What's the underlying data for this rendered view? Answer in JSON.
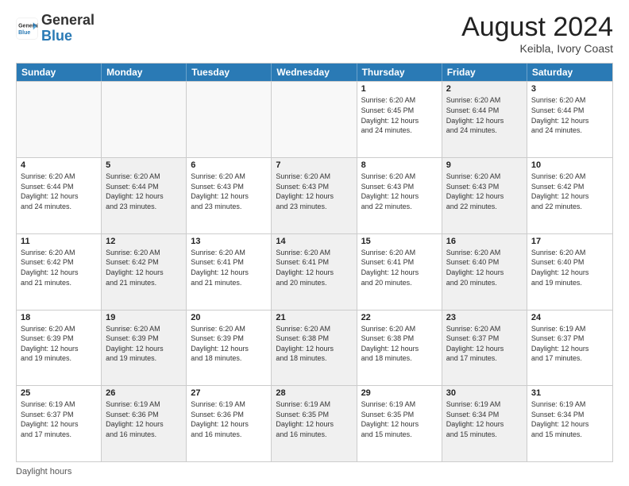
{
  "header": {
    "logo_general": "General",
    "logo_blue": "Blue",
    "month_year": "August 2024",
    "location": "Keibla, Ivory Coast"
  },
  "days_of_week": [
    "Sunday",
    "Monday",
    "Tuesday",
    "Wednesday",
    "Thursday",
    "Friday",
    "Saturday"
  ],
  "footer": {
    "label": "Daylight hours"
  },
  "weeks": [
    [
      {
        "day": "",
        "empty": true
      },
      {
        "day": "",
        "empty": true
      },
      {
        "day": "",
        "empty": true
      },
      {
        "day": "",
        "empty": true
      },
      {
        "day": "1",
        "lines": [
          "Sunrise: 6:20 AM",
          "Sunset: 6:45 PM",
          "Daylight: 12 hours",
          "and 24 minutes."
        ],
        "shaded": false
      },
      {
        "day": "2",
        "lines": [
          "Sunrise: 6:20 AM",
          "Sunset: 6:44 PM",
          "Daylight: 12 hours",
          "and 24 minutes."
        ],
        "shaded": true
      },
      {
        "day": "3",
        "lines": [
          "Sunrise: 6:20 AM",
          "Sunset: 6:44 PM",
          "Daylight: 12 hours",
          "and 24 minutes."
        ],
        "shaded": false
      }
    ],
    [
      {
        "day": "4",
        "lines": [
          "Sunrise: 6:20 AM",
          "Sunset: 6:44 PM",
          "Daylight: 12 hours",
          "and 24 minutes."
        ],
        "shaded": false
      },
      {
        "day": "5",
        "lines": [
          "Sunrise: 6:20 AM",
          "Sunset: 6:44 PM",
          "Daylight: 12 hours",
          "and 23 minutes."
        ],
        "shaded": true
      },
      {
        "day": "6",
        "lines": [
          "Sunrise: 6:20 AM",
          "Sunset: 6:43 PM",
          "Daylight: 12 hours",
          "and 23 minutes."
        ],
        "shaded": false
      },
      {
        "day": "7",
        "lines": [
          "Sunrise: 6:20 AM",
          "Sunset: 6:43 PM",
          "Daylight: 12 hours",
          "and 23 minutes."
        ],
        "shaded": true
      },
      {
        "day": "8",
        "lines": [
          "Sunrise: 6:20 AM",
          "Sunset: 6:43 PM",
          "Daylight: 12 hours",
          "and 22 minutes."
        ],
        "shaded": false
      },
      {
        "day": "9",
        "lines": [
          "Sunrise: 6:20 AM",
          "Sunset: 6:43 PM",
          "Daylight: 12 hours",
          "and 22 minutes."
        ],
        "shaded": true
      },
      {
        "day": "10",
        "lines": [
          "Sunrise: 6:20 AM",
          "Sunset: 6:42 PM",
          "Daylight: 12 hours",
          "and 22 minutes."
        ],
        "shaded": false
      }
    ],
    [
      {
        "day": "11",
        "lines": [
          "Sunrise: 6:20 AM",
          "Sunset: 6:42 PM",
          "Daylight: 12 hours",
          "and 21 minutes."
        ],
        "shaded": false
      },
      {
        "day": "12",
        "lines": [
          "Sunrise: 6:20 AM",
          "Sunset: 6:42 PM",
          "Daylight: 12 hours",
          "and 21 minutes."
        ],
        "shaded": true
      },
      {
        "day": "13",
        "lines": [
          "Sunrise: 6:20 AM",
          "Sunset: 6:41 PM",
          "Daylight: 12 hours",
          "and 21 minutes."
        ],
        "shaded": false
      },
      {
        "day": "14",
        "lines": [
          "Sunrise: 6:20 AM",
          "Sunset: 6:41 PM",
          "Daylight: 12 hours",
          "and 20 minutes."
        ],
        "shaded": true
      },
      {
        "day": "15",
        "lines": [
          "Sunrise: 6:20 AM",
          "Sunset: 6:41 PM",
          "Daylight: 12 hours",
          "and 20 minutes."
        ],
        "shaded": false
      },
      {
        "day": "16",
        "lines": [
          "Sunrise: 6:20 AM",
          "Sunset: 6:40 PM",
          "Daylight: 12 hours",
          "and 20 minutes."
        ],
        "shaded": true
      },
      {
        "day": "17",
        "lines": [
          "Sunrise: 6:20 AM",
          "Sunset: 6:40 PM",
          "Daylight: 12 hours",
          "and 19 minutes."
        ],
        "shaded": false
      }
    ],
    [
      {
        "day": "18",
        "lines": [
          "Sunrise: 6:20 AM",
          "Sunset: 6:39 PM",
          "Daylight: 12 hours",
          "and 19 minutes."
        ],
        "shaded": false
      },
      {
        "day": "19",
        "lines": [
          "Sunrise: 6:20 AM",
          "Sunset: 6:39 PM",
          "Daylight: 12 hours",
          "and 19 minutes."
        ],
        "shaded": true
      },
      {
        "day": "20",
        "lines": [
          "Sunrise: 6:20 AM",
          "Sunset: 6:39 PM",
          "Daylight: 12 hours",
          "and 18 minutes."
        ],
        "shaded": false
      },
      {
        "day": "21",
        "lines": [
          "Sunrise: 6:20 AM",
          "Sunset: 6:38 PM",
          "Daylight: 12 hours",
          "and 18 minutes."
        ],
        "shaded": true
      },
      {
        "day": "22",
        "lines": [
          "Sunrise: 6:20 AM",
          "Sunset: 6:38 PM",
          "Daylight: 12 hours",
          "and 18 minutes."
        ],
        "shaded": false
      },
      {
        "day": "23",
        "lines": [
          "Sunrise: 6:20 AM",
          "Sunset: 6:37 PM",
          "Daylight: 12 hours",
          "and 17 minutes."
        ],
        "shaded": true
      },
      {
        "day": "24",
        "lines": [
          "Sunrise: 6:19 AM",
          "Sunset: 6:37 PM",
          "Daylight: 12 hours",
          "and 17 minutes."
        ],
        "shaded": false
      }
    ],
    [
      {
        "day": "25",
        "lines": [
          "Sunrise: 6:19 AM",
          "Sunset: 6:37 PM",
          "Daylight: 12 hours",
          "and 17 minutes."
        ],
        "shaded": false
      },
      {
        "day": "26",
        "lines": [
          "Sunrise: 6:19 AM",
          "Sunset: 6:36 PM",
          "Daylight: 12 hours",
          "and 16 minutes."
        ],
        "shaded": true
      },
      {
        "day": "27",
        "lines": [
          "Sunrise: 6:19 AM",
          "Sunset: 6:36 PM",
          "Daylight: 12 hours",
          "and 16 minutes."
        ],
        "shaded": false
      },
      {
        "day": "28",
        "lines": [
          "Sunrise: 6:19 AM",
          "Sunset: 6:35 PM",
          "Daylight: 12 hours",
          "and 16 minutes."
        ],
        "shaded": true
      },
      {
        "day": "29",
        "lines": [
          "Sunrise: 6:19 AM",
          "Sunset: 6:35 PM",
          "Daylight: 12 hours",
          "and 15 minutes."
        ],
        "shaded": false
      },
      {
        "day": "30",
        "lines": [
          "Sunrise: 6:19 AM",
          "Sunset: 6:34 PM",
          "Daylight: 12 hours",
          "and 15 minutes."
        ],
        "shaded": true
      },
      {
        "day": "31",
        "lines": [
          "Sunrise: 6:19 AM",
          "Sunset: 6:34 PM",
          "Daylight: 12 hours",
          "and 15 minutes."
        ],
        "shaded": false
      }
    ]
  ]
}
